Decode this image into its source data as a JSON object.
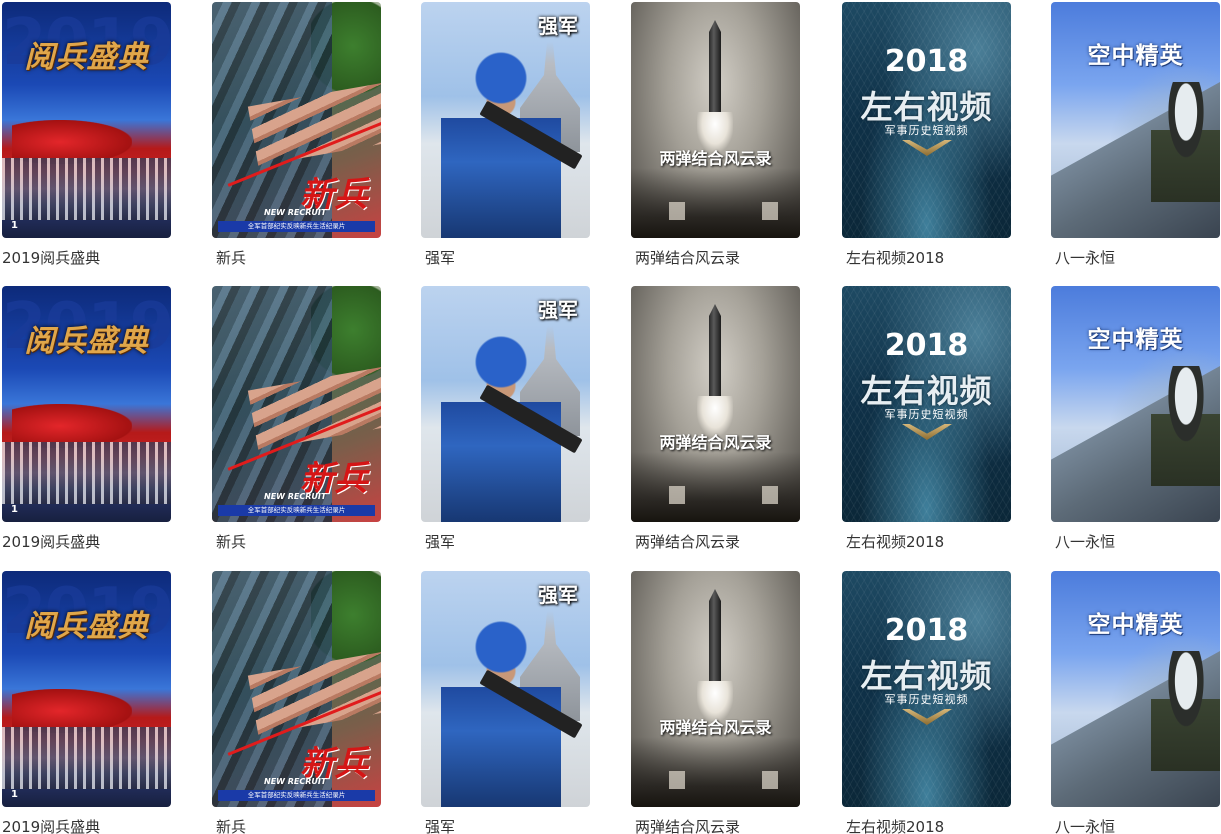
{
  "rows": [
    {
      "items": [
        {
          "title": "2019阅兵盛典",
          "badge": "1",
          "poster_text": "阅兵盛典",
          "poster_number": "2019"
        },
        {
          "title": "新兵",
          "poster_text": "新兵",
          "poster_sub": "NEW RECRUIT",
          "poster_caption": "全军首部纪实反映新兵生活纪录片"
        },
        {
          "title": "强军",
          "poster_text": "强军"
        },
        {
          "title": "两弹结合风云录",
          "poster_text": "两弹结合风云录"
        },
        {
          "title": "左右视频2018",
          "poster_year": "2018",
          "poster_text": "左右视频",
          "poster_sub": "军事历史短视频"
        },
        {
          "title": "八一永恒",
          "poster_text": "空中精英"
        }
      ]
    },
    {
      "items": [
        {
          "title": "2019阅兵盛典",
          "badge": "1",
          "poster_text": "阅兵盛典",
          "poster_number": "2019"
        },
        {
          "title": "新兵",
          "poster_text": "新兵",
          "poster_sub": "NEW RECRUIT",
          "poster_caption": "全军首部纪实反映新兵生活纪录片"
        },
        {
          "title": "强军",
          "poster_text": "强军"
        },
        {
          "title": "两弹结合风云录",
          "poster_text": "两弹结合风云录"
        },
        {
          "title": "左右视频2018",
          "poster_year": "2018",
          "poster_text": "左右视频",
          "poster_sub": "军事历史短视频"
        },
        {
          "title": "八一永恒",
          "poster_text": "空中精英"
        }
      ]
    },
    {
      "items": [
        {
          "title": "2019阅兵盛典",
          "badge": "1",
          "poster_text": "阅兵盛典",
          "poster_number": "2019"
        },
        {
          "title": "新兵",
          "poster_text": "新兵",
          "poster_sub": "NEW RECRUIT",
          "poster_caption": "全军首部纪实反映新兵生活纪录片"
        },
        {
          "title": "强军",
          "poster_text": "强军"
        },
        {
          "title": "两弹结合风云录",
          "poster_text": "两弹结合风云录"
        },
        {
          "title": "左右视频2018",
          "poster_year": "2018",
          "poster_text": "左右视频",
          "poster_sub": "军事历史短视频"
        },
        {
          "title": "八一永恒",
          "poster_text": "空中精英"
        }
      ]
    }
  ]
}
